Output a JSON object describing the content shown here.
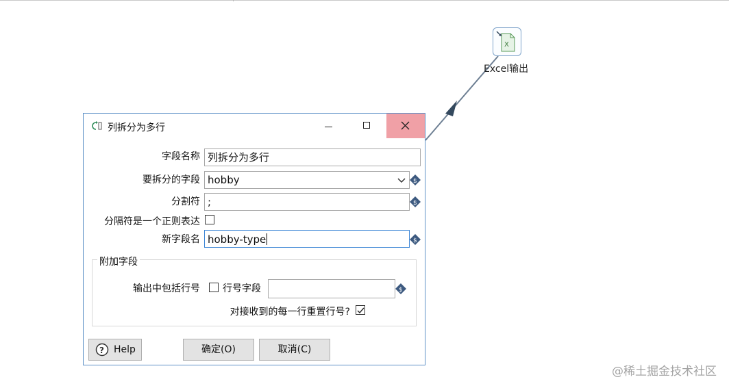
{
  "canvas": {
    "step": {
      "name": "Excel输出",
      "icon": "excel-output-icon"
    },
    "hop_color": "#6d7f93",
    "watermark": "@稀土掘金技术社区"
  },
  "dialog": {
    "title": "列拆分为多行",
    "title_icon": "split-rows-icon",
    "close_color": "#f0a0a6",
    "fields": {
      "field_name": {
        "label": "字段名称",
        "value": "列拆分为多行"
      },
      "split_field": {
        "label": "要拆分的字段",
        "value": "hobby"
      },
      "delimiter": {
        "label": "分割符",
        "value": ";"
      },
      "regex": {
        "label": "分隔符是一个正则表达",
        "checked": false
      },
      "new_field": {
        "label": "新字段名",
        "value": "hobby-type"
      }
    },
    "extra": {
      "title": "附加字段",
      "include_rownum": {
        "label": "输出中包括行号",
        "checked": false
      },
      "rownum_field": {
        "label": "行号字段",
        "value": ""
      },
      "reset_rownum": {
        "label": "对接收到的每一行重置行号?",
        "checked": true
      }
    },
    "buttons": {
      "help": "Help",
      "ok": "确定(O)",
      "cancel": "取消(C)"
    }
  }
}
